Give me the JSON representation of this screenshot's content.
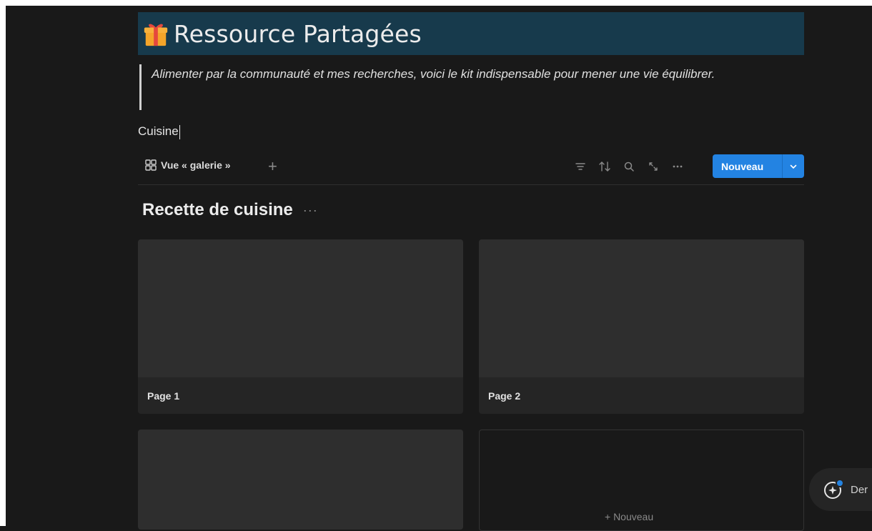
{
  "header": {
    "title": "Ressource Partagées",
    "icon": "gift-icon"
  },
  "quote": {
    "text": "Alimenter par la communauté et mes recherches, voici le kit indispensable pour mener une vie équilibrer."
  },
  "block_text": "Cuisine",
  "view_bar": {
    "view_label": "Vue « galerie »",
    "tools": [
      "filter-icon",
      "sort-icon",
      "search-icon",
      "expand-icon",
      "more-icon"
    ],
    "new_button_label": "Nouveau"
  },
  "database": {
    "title": "Recette de cuisine",
    "cards": [
      {
        "title": "Page 1"
      },
      {
        "title": "Page 2"
      },
      {
        "title": ""
      }
    ],
    "new_card_label": "+ Nouveau"
  },
  "assistant": {
    "label": "Der"
  },
  "colors": {
    "background": "#191919",
    "title_bar": "#173a4c",
    "accent": "#2383e2",
    "card": "#252525"
  }
}
